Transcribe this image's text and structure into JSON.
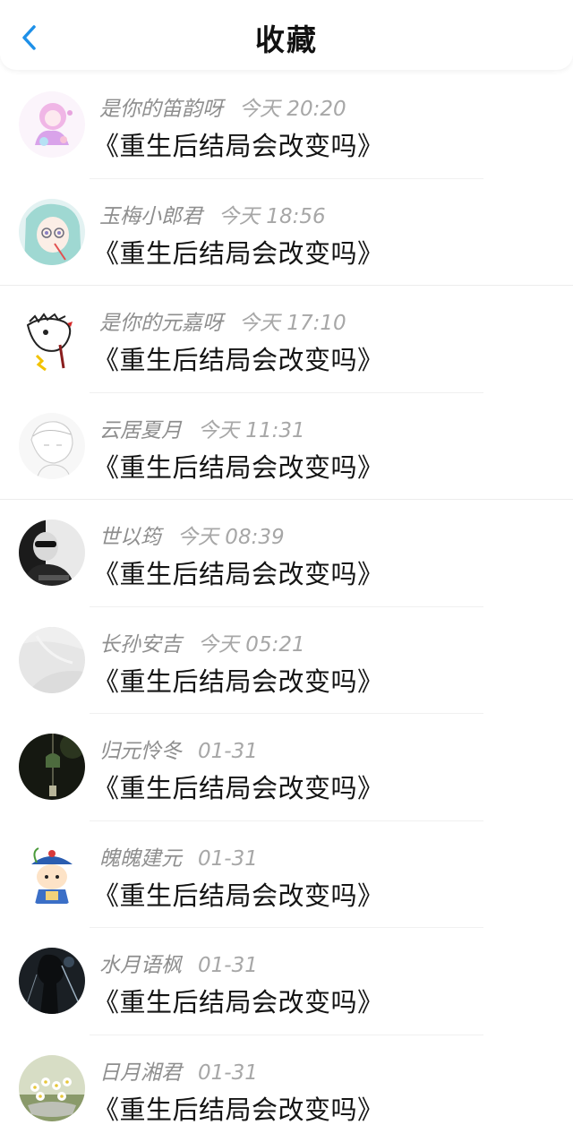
{
  "header": {
    "title": "收藏",
    "back_icon": "chevron-left-icon",
    "accent_color": "#1e90e8"
  },
  "items": [
    {
      "user": "是你的笛韵呀",
      "time": "今天 20:20",
      "work": "《重生后结局会改变吗》",
      "avatar_icon": "anime-pink-character-avatar"
    },
    {
      "user": "玉梅小郎君",
      "time": "今天 18:56",
      "work": "《重生后结局会改变吗》",
      "avatar_icon": "anime-teal-hair-glasses-avatar"
    },
    {
      "user": "是你的元嘉呀",
      "time": "今天 17:10",
      "work": "《重生后结局会改变吗》",
      "avatar_icon": "cartoon-bird-sketch-avatar"
    },
    {
      "user": "云居夏月",
      "time": "今天 11:31",
      "work": "《重生后结局会改变吗》",
      "avatar_icon": "pencil-sketch-boy-avatar"
    },
    {
      "user": "世以筠",
      "time": "今天 08:39",
      "work": "《重生后结局会改变吗》",
      "avatar_icon": "black-white-photo-avatar"
    },
    {
      "user": "长孙安吉",
      "time": "今天 05:21",
      "work": "《重生后结局会改变吗》",
      "avatar_icon": "grey-texture-avatar"
    },
    {
      "user": "归元怜冬",
      "time": "01-31",
      "work": "《重生后结局会改变吗》",
      "avatar_icon": "dark-wind-chime-avatar"
    },
    {
      "user": "魄魄建元",
      "time": "01-31",
      "work": "《重生后结局会改变吗》",
      "avatar_icon": "qing-official-cartoon-avatar"
    },
    {
      "user": "水月语枫",
      "time": "01-31",
      "work": "《重生后结局会改变吗》",
      "avatar_icon": "dark-figure-avatar"
    },
    {
      "user": "日月湘君",
      "time": "01-31",
      "work": "《重生后结局会改变吗》",
      "avatar_icon": "white-flowers-avatar"
    }
  ]
}
